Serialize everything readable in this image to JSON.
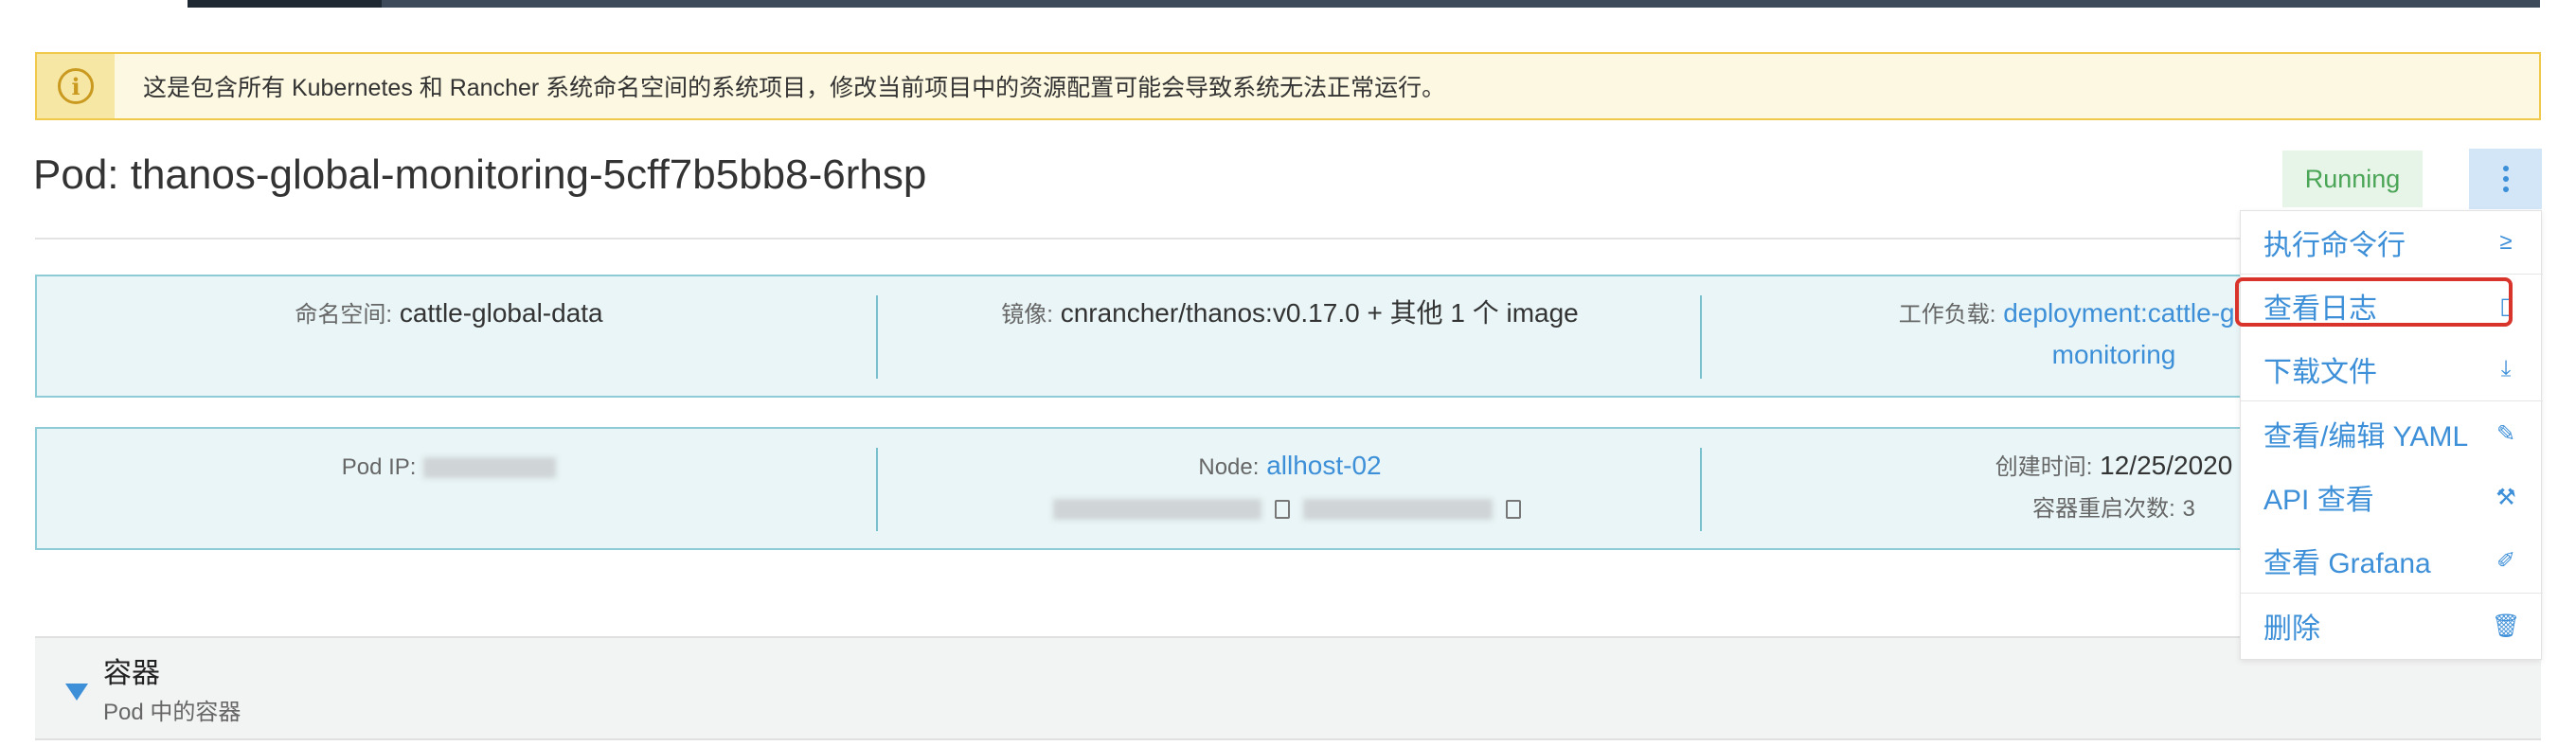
{
  "banner": {
    "icon": "info-circle-icon",
    "text": "这是包含所有 Kubernetes 和 Rancher 系统命名空间的系统项目，修改当前项目中的资源配置可能会导致系统无法正常运行。"
  },
  "header": {
    "title": "Pod: thanos-global-monitoring-5cff7b5bb8-6rhsp",
    "status": "Running",
    "menu_icon": "more-vertical-icon"
  },
  "info_row1": {
    "namespace_label": "命名空间:",
    "namespace_value": "cattle-global-data",
    "image_label": "镜像:",
    "image_value": "cnrancher/thanos:v0.17.0",
    "image_more": "+ 其他 1 个 image",
    "workload_label": "工作负载:",
    "workload_value_line1": "deployment:cattle-global-da",
    "workload_value_line2": "monitoring"
  },
  "info_row2": {
    "pod_ip_label": "Pod IP:",
    "node_label": "Node:",
    "node_value": "allhost-02",
    "created_label": "创建时间:",
    "created_value": "12/25/2020",
    "restarts_label": "容器重启次数:",
    "restarts_value": "3"
  },
  "section": {
    "title": "容器",
    "subtitle": "Pod 中的容器"
  },
  "menu": {
    "items": [
      {
        "label": "执行命令行",
        "icon": "terminal-icon",
        "glyph": "≥"
      },
      {
        "label": "查看日志",
        "icon": "file-icon",
        "glyph": "▯"
      },
      {
        "label": "下载文件",
        "icon": "download-icon",
        "glyph": "⤓"
      },
      {
        "label": "查看/编辑 YAML",
        "icon": "edit-icon",
        "glyph": "✎"
      },
      {
        "label": "API 查看",
        "icon": "tools-icon",
        "glyph": "⚒"
      },
      {
        "label": "查看 Grafana",
        "icon": "pencil-icon",
        "glyph": "✐"
      },
      {
        "label": "删除",
        "icon": "trash-icon",
        "glyph": "🗑"
      }
    ]
  },
  "colors": {
    "accent": "#3d8fd8",
    "running": "#4aa556",
    "warning_border": "#f1c94a",
    "highlight": "#d9342b"
  }
}
